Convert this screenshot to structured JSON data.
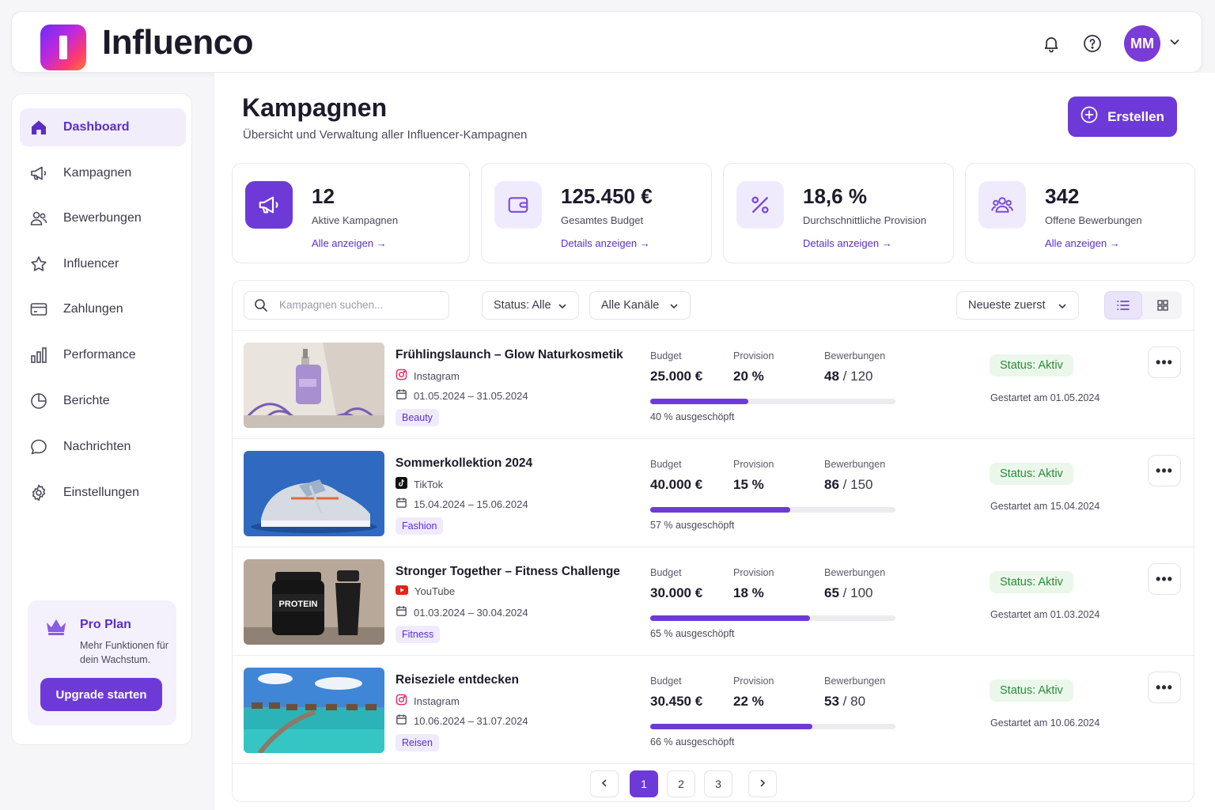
{
  "app": {
    "brand": "Influenco",
    "avatar_initials": "MM"
  },
  "sidebar": {
    "items": [
      {
        "label": "Dashboard",
        "icon": "home-icon",
        "active": true
      },
      {
        "label": "Kampagnen",
        "icon": "megaphone-icon"
      },
      {
        "label": "Bewerbungen",
        "icon": "users-icon"
      },
      {
        "label": "Influencer",
        "icon": "star-icon"
      },
      {
        "label": "Zahlungen",
        "icon": "credit-card-icon"
      },
      {
        "label": "Performance",
        "icon": "bar-chart-icon"
      },
      {
        "label": "Berichte",
        "icon": "pie-chart-icon"
      },
      {
        "label": "Nachrichten",
        "icon": "chat-icon"
      },
      {
        "label": "Einstellungen",
        "icon": "gear-icon"
      }
    ],
    "pro": {
      "title": "Pro Plan",
      "text": "Mehr Funktionen für dein Wachstum.",
      "button": "Upgrade starten"
    }
  },
  "header": {
    "title": "Kampagnen",
    "subtitle": "Übersicht und Verwaltung aller Influencer-Kampagnen",
    "create_label": "Erstellen"
  },
  "stats": [
    {
      "value": "12",
      "label": "Aktive Kampagnen",
      "link": "Alle anzeigen",
      "icon": "megaphone-icon"
    },
    {
      "value": "125.450 €",
      "label": "Gesamtes Budget",
      "link": "Details anzeigen",
      "icon": "wallet-icon"
    },
    {
      "value": "18,6 %",
      "label": "Durchschnittliche Provision",
      "link": "Details anzeigen",
      "icon": "percent-icon"
    },
    {
      "value": "342",
      "label": "Offene Bewerbungen",
      "link": "Alle anzeigen",
      "icon": "group-icon"
    }
  ],
  "filters": {
    "search_placeholder": "Kampagnen suchen...",
    "status": "Status: Alle",
    "channels": "Alle Kanäle",
    "sort": "Neueste zuerst"
  },
  "labels": {
    "budget": "Budget",
    "provision": "Provision",
    "bewerbungen": "Bewerbungen",
    "separator": "/"
  },
  "campaigns": [
    {
      "title": "Frühlingslaunch – Glow Naturkosmetik",
      "platform": "Instagram",
      "dates": "01.05.2024 – 31.05.2024",
      "tag": "Beauty",
      "budget": "25.000 €",
      "provision": "20 %",
      "applications": "48",
      "applications_max": "120",
      "progress": 40,
      "progress_text": "40 % ausgeschöpft",
      "status": "Status: Aktiv",
      "started": "Gestartet am 01.05.2024"
    },
    {
      "title": "Sommerkollektion 2024",
      "platform": "TikTok",
      "dates": "15.04.2024 – 15.06.2024",
      "tag": "Fashion",
      "budget": "40.000 €",
      "provision": "15 %",
      "applications": "86",
      "applications_max": "150",
      "progress": 57,
      "progress_text": "57 % ausgeschöpft",
      "status": "Status: Aktiv",
      "started": "Gestartet am 15.04.2024"
    },
    {
      "title": "Stronger Together – Fitness Challenge",
      "platform": "YouTube",
      "dates": "01.03.2024 – 30.04.2024",
      "tag": "Fitness",
      "budget": "30.000 €",
      "provision": "18 %",
      "applications": "65",
      "applications_max": "100",
      "progress": 65,
      "progress_text": "65 % ausgeschöpft",
      "status": "Status: Aktiv",
      "started": "Gestartet am 01.03.2024",
      "thumb_text": "PROTEIN"
    },
    {
      "title": "Reiseziele entdecken",
      "platform": "Instagram",
      "dates": "10.06.2024 – 31.07.2024",
      "tag": "Reisen",
      "budget": "30.450 €",
      "provision": "22 %",
      "applications": "53",
      "applications_max": "80",
      "progress": 66,
      "progress_text": "66 % ausgeschöpft",
      "status": "Status: Aktiv",
      "started": "Gestartet am 10.06.2024"
    }
  ],
  "pagination": {
    "pages": [
      "1",
      "2",
      "3"
    ],
    "current": "1"
  },
  "colors": {
    "accent": "#6d3ad8",
    "status_green": "#2b8a3a"
  }
}
